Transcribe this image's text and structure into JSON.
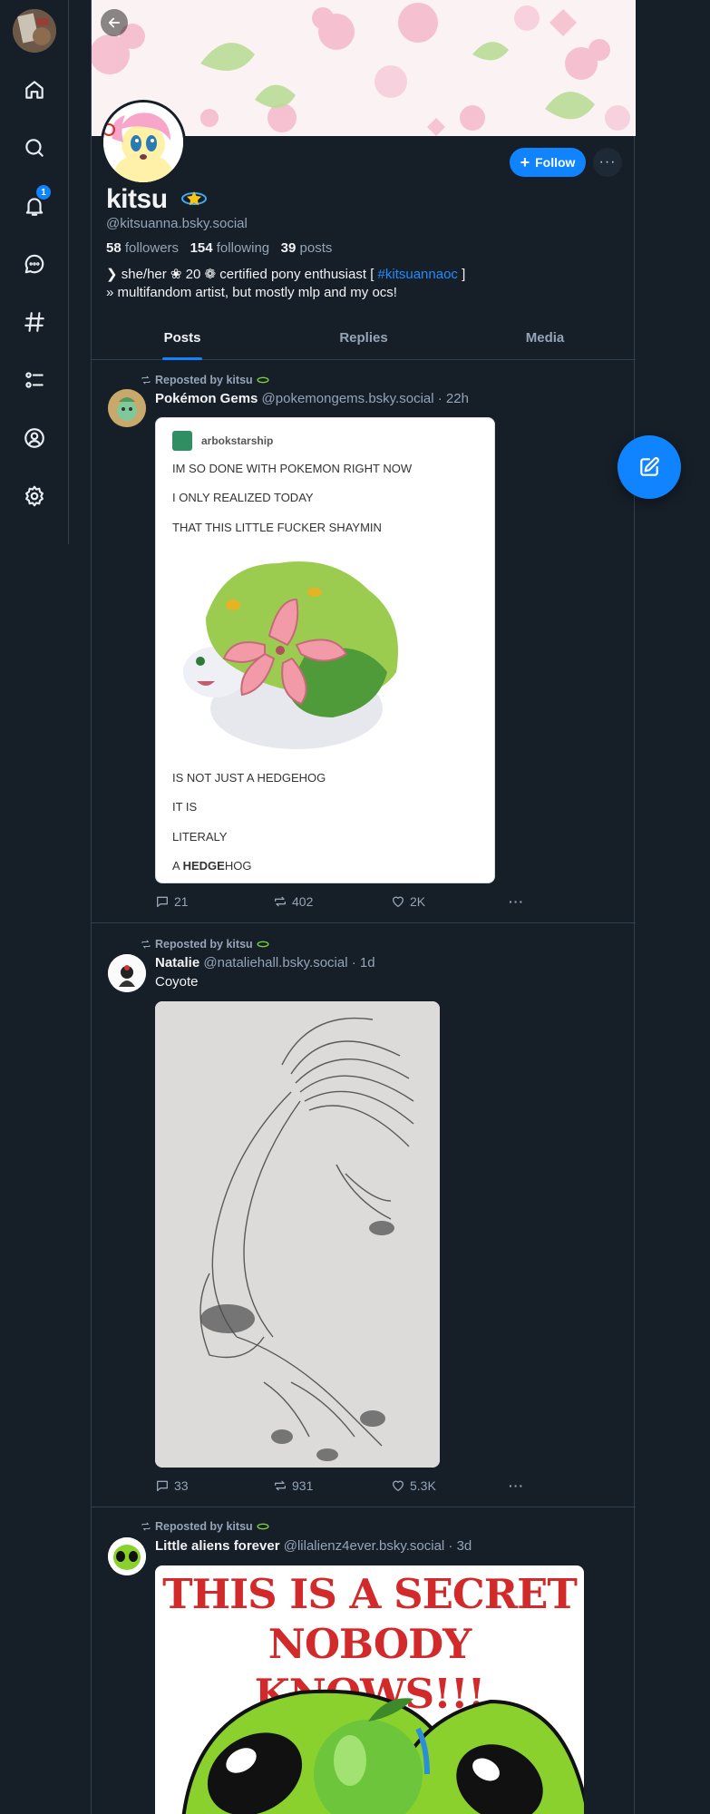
{
  "nav": {
    "notification_count": "1",
    "items": [
      "home-icon",
      "search-icon",
      "notifications-icon",
      "chat-icon",
      "feeds-icon",
      "lists-icon",
      "profile-icon",
      "settings-icon"
    ]
  },
  "profile": {
    "display_name": "kitsu",
    "handle": "@kitsuanna.bsky.social",
    "followers_count": "58",
    "followers_label": "followers",
    "following_count": "154",
    "following_label": "following",
    "posts_count": "39",
    "posts_label": "posts",
    "bio_line1_prefix": "❯ she/her ❀ 20 ❁ certified pony enthusiast [ ",
    "bio_line1_tag": "#kitsuannaoc",
    "bio_line1_suffix": " ]",
    "bio_line2": "» multifandom artist, but mostly mlp and my ocs!",
    "follow_label": "Follow",
    "more_label": "···"
  },
  "tabs": [
    "Posts",
    "Replies",
    "Media"
  ],
  "posts": [
    {
      "repost_label": "Reposted by kitsu",
      "author": "Pokémon Gems",
      "meta": "@pokemongems.bsky.social · 22h",
      "embed": {
        "tumblr_user": "arbokstarship",
        "lines_top": [
          "IM SO DONE WITH POKEMON RIGHT NOW",
          "I ONLY REALIZED TODAY",
          "THAT THIS LITTLE FUCKER SHAYMIN"
        ],
        "lines_bottom": [
          "IS NOT JUST A HEDGEHOG",
          "IT IS",
          "LITERALY"
        ],
        "last_line_prefix": "A ",
        "last_line_bold": "HEDGE",
        "last_line_suffix": "HOG"
      },
      "replies": "21",
      "reposts": "402",
      "likes": "2K"
    },
    {
      "repost_label": "Reposted by kitsu",
      "author": "Natalie",
      "meta": "@nataliehall.bsky.social · 1d",
      "text": "Coyote",
      "replies": "33",
      "reposts": "931",
      "likes": "5.3K"
    },
    {
      "repost_label": "Reposted by kitsu",
      "author": "Little aliens forever",
      "meta": "@lilalienz4ever.bsky.social · 3d",
      "image_text_line1": "THIS IS A SECRET",
      "image_text_line2": "NOBODY KNOWS!!!"
    }
  ],
  "colors": {
    "accent": "#1083fe",
    "background": "#161e27",
    "border": "#2e4052",
    "muted": "#93a5b7"
  }
}
